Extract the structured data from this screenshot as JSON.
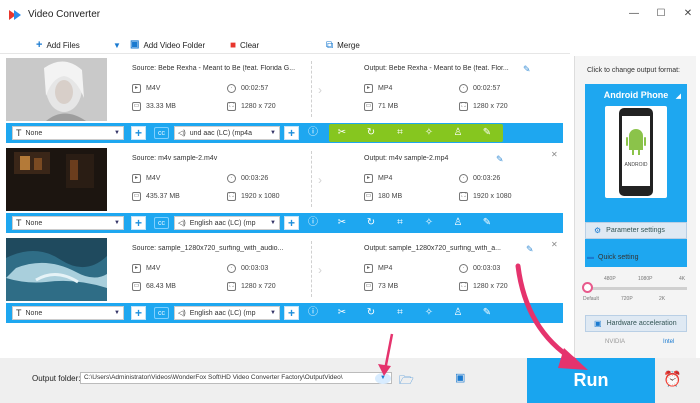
{
  "app": {
    "title": "Video Converter"
  },
  "toolbar": {
    "add_files": "Add Files",
    "add_folder": "Add Video Folder",
    "clear": "Clear",
    "merge": "Merge"
  },
  "rows": [
    {
      "source": "Source: Bebe Rexha - Meant to Be (feat. Florida G...",
      "src_format": "M4V",
      "src_duration": "00:02:57",
      "src_size": "33.33 MB",
      "src_res": "1280 x 720",
      "output": "Output: Bebe Rexha - Meant to Be (feat. Flor...",
      "out_format": "MP4",
      "out_duration": "00:02:57",
      "out_size": "71 MB",
      "out_res": "1280 x 720",
      "subtitle": "None",
      "audio": "und aac (LC) (mp4a"
    },
    {
      "source": "Source: m4v sample-2.m4v",
      "src_format": "M4V",
      "src_duration": "00:03:26",
      "src_size": "435.37 MB",
      "src_res": "1920 x 1080",
      "output": "Output: m4v sample-2.mp4",
      "out_format": "MP4",
      "out_duration": "00:03:26",
      "out_size": "180 MB",
      "out_res": "1920 x 1080",
      "subtitle": "None",
      "audio": "English aac (LC) (mp"
    },
    {
      "source": "Source: sample_1280x720_surfing_with_audio...",
      "src_format": "M4V",
      "src_duration": "00:03:03",
      "src_size": "68.43 MB",
      "src_res": "1280 x 720",
      "output": "Output: sample_1280x720_surfing_with_a...",
      "out_format": "MP4",
      "out_duration": "00:03:03",
      "out_size": "73 MB",
      "out_res": "1280 x 720",
      "subtitle": "None",
      "audio": "English aac (LC) (mp"
    }
  ],
  "row_cc": "cc",
  "side": {
    "label": "Click to change output format:",
    "device": "Android Phone",
    "phone_brand": "ANDROID",
    "param": "Parameter settings",
    "quick": "Quick setting",
    "ticks_top": [
      "480P",
      "1080P",
      "4K"
    ],
    "ticks_bottom": [
      "Default",
      "720P",
      "2K"
    ],
    "hw": "Hardware acceleration",
    "chip_nvidia": "NVIDIA",
    "chip_intel": "Intel"
  },
  "bottom": {
    "output_folder_label": "Output folder:",
    "output_folder_path": "C:\\Users\\Administrator\\Videos\\WonderFox Soft\\HD Video Converter Factory\\OutputVideo\\",
    "run": "Run"
  },
  "colors": {
    "accent": "#1ea7f0",
    "toolbar_green": "#86c61f",
    "highlight": "#e5336d"
  }
}
